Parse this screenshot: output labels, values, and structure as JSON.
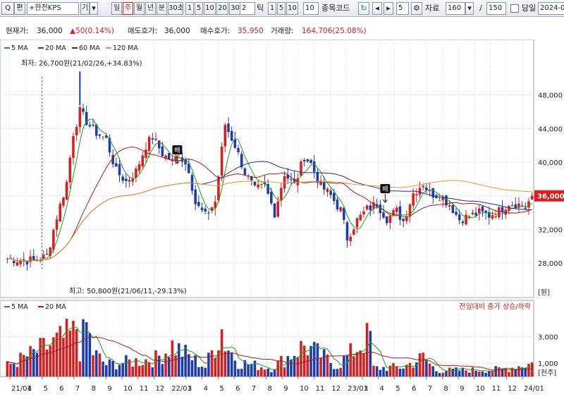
{
  "toolbar": {
    "search_label": "Q",
    "stock_code_label": "편",
    "stock_name": "+한전KPS",
    "stock_tag": "기",
    "code_icon": "search-icon",
    "periods": [
      "일",
      "주",
      "월",
      "년",
      "분",
      "30초"
    ],
    "active_period": "주",
    "minute_buttons": [
      "1",
      "5",
      "10",
      "20",
      "30"
    ],
    "tick_value": "2",
    "tick_label": "틱",
    "tick_buttons": [
      "1",
      "5",
      "10"
    ],
    "tick_input": "10",
    "code_group_label": "종목코드",
    "step_value": "5",
    "data_label": "자료",
    "data_count": "160",
    "separator": "/",
    "total_count": "150",
    "today_label": "당일",
    "date_value": "2024-0"
  },
  "quote": {
    "price_label": "현재가:",
    "price": "36,000",
    "change": "▲50(0.14%)",
    "ask_label": "매도호가:",
    "ask": "36,000",
    "bid_label": "매수호가:",
    "bid": "35,950",
    "volume_label": "거래량:",
    "volume": "164,706(25.08%)"
  },
  "legend_main": [
    {
      "label": "5 MA",
      "color": "#17a317"
    },
    {
      "label": "20 MA",
      "color": "#b01818"
    },
    {
      "label": "60 MA",
      "color": "#1a2fa8"
    },
    {
      "label": "120 MA",
      "color": "#e69a1d"
    }
  ],
  "legend_vol": [
    {
      "label": "5 MA",
      "color": "#17a317"
    },
    {
      "label": "20 MA",
      "color": "#b01818"
    }
  ],
  "colors": {
    "up": "#d81e1e",
    "down": "#1c3bb0",
    "ma5": "#17a317",
    "ma20": "#b01818",
    "ma60": "#1a2fa8",
    "ma120": "#e69a1d",
    "volume_label": "#c81e1e"
  },
  "annotations": {
    "low": "최저: 26,700원(21/02/26,+34.83%)",
    "high": "최고: 50,800원(21/06/11,-29.13%)",
    "vol_note": "전일대비 종가 상승/하락",
    "badge": "배",
    "price_tag": "36,000"
  },
  "price_axis": {
    "ticks": [
      "48,000",
      "44,000",
      "40,000",
      "36,000",
      "32,000",
      "28,000"
    ],
    "unit": "[원]",
    "ylim": [
      26700,
      50800
    ]
  },
  "volume_axis": {
    "ticks": [
      "3,000",
      "1,000"
    ],
    "unit": "[천주]"
  },
  "x_labels": [
    "21/01",
    "4",
    "5",
    "6",
    "7",
    "8",
    "9",
    "10",
    "11",
    "12",
    "22/01",
    "3",
    "4",
    "5",
    "6",
    "7",
    "8",
    "9",
    "10",
    "11",
    "12",
    "23/01",
    "3",
    "4",
    "5",
    "6",
    "7",
    "8",
    "9",
    "10",
    "11",
    "12",
    "24/01"
  ],
  "chart_data": {
    "type": "candlestick",
    "period": "weekly",
    "y_range": [
      26700,
      50800
    ],
    "weeks": 160,
    "current_price": 36000,
    "high": {
      "value": 50800,
      "date": "21/06/11"
    },
    "low": {
      "value": 26700,
      "date": "21/02/26"
    },
    "x_tick_labels": [
      "21/01",
      "4",
      "5",
      "6",
      "7",
      "8",
      "9",
      "10",
      "11",
      "12",
      "22/01",
      "3",
      "4",
      "5",
      "6",
      "7",
      "8",
      "9",
      "10",
      "11",
      "12",
      "23/01",
      "3",
      "4",
      "5",
      "6",
      "7",
      "8",
      "9",
      "10",
      "11",
      "12",
      "24/01"
    ],
    "close_anchors": [
      [
        0,
        28500
      ],
      [
        8,
        28300
      ],
      [
        12,
        28800
      ],
      [
        15,
        33500
      ],
      [
        18,
        37600
      ],
      [
        20,
        43500
      ],
      [
        22,
        46000
      ],
      [
        26,
        43800
      ],
      [
        30,
        42700
      ],
      [
        33,
        38900
      ],
      [
        36,
        37700
      ],
      [
        39,
        38900
      ],
      [
        42,
        42000
      ],
      [
        44,
        43000
      ],
      [
        47,
        41000
      ],
      [
        50,
        40100
      ],
      [
        52,
        41000
      ],
      [
        55,
        39200
      ],
      [
        57,
        35100
      ],
      [
        60,
        33600
      ],
      [
        63,
        35300
      ],
      [
        66,
        44500
      ],
      [
        69,
        42000
      ],
      [
        72,
        38800
      ],
      [
        75,
        36700
      ],
      [
        78,
        37100
      ],
      [
        81,
        34000
      ],
      [
        84,
        38700
      ],
      [
        87,
        37200
      ],
      [
        90,
        40700
      ],
      [
        92,
        39800
      ],
      [
        95,
        37200
      ],
      [
        98,
        36000
      ],
      [
        101,
        34300
      ],
      [
        103,
        31000
      ],
      [
        106,
        33100
      ],
      [
        109,
        34400
      ],
      [
        112,
        35100
      ],
      [
        115,
        33300
      ],
      [
        118,
        34200
      ],
      [
        120,
        33000
      ],
      [
        123,
        36300
      ],
      [
        126,
        37500
      ],
      [
        128,
        36300
      ],
      [
        131,
        36100
      ],
      [
        134,
        35000
      ],
      [
        137,
        33200
      ],
      [
        140,
        33600
      ],
      [
        143,
        34000
      ],
      [
        146,
        33700
      ],
      [
        149,
        34200
      ],
      [
        152,
        35200
      ],
      [
        155,
        35000
      ],
      [
        157,
        34600
      ],
      [
        159,
        36000
      ]
    ],
    "volume_anchors": [
      [
        0,
        900
      ],
      [
        20,
        3500
      ],
      [
        21,
        4200
      ],
      [
        22,
        2200
      ],
      [
        24,
        4300
      ],
      [
        26,
        2000
      ],
      [
        30,
        1000
      ],
      [
        45,
        1500
      ],
      [
        50,
        2600
      ],
      [
        60,
        800
      ],
      [
        64,
        3300
      ],
      [
        65,
        4000
      ],
      [
        66,
        2800
      ],
      [
        70,
        1200
      ],
      [
        80,
        700
      ],
      [
        90,
        2600
      ],
      [
        100,
        900
      ],
      [
        110,
        3400
      ],
      [
        111,
        700
      ],
      [
        120,
        800
      ],
      [
        126,
        1600
      ],
      [
        130,
        500
      ],
      [
        150,
        600
      ],
      [
        159,
        1100
      ]
    ],
    "moving_averages": [
      "5",
      "20",
      "60",
      "120"
    ],
    "volume_moving_averages": [
      "5",
      "20"
    ]
  }
}
